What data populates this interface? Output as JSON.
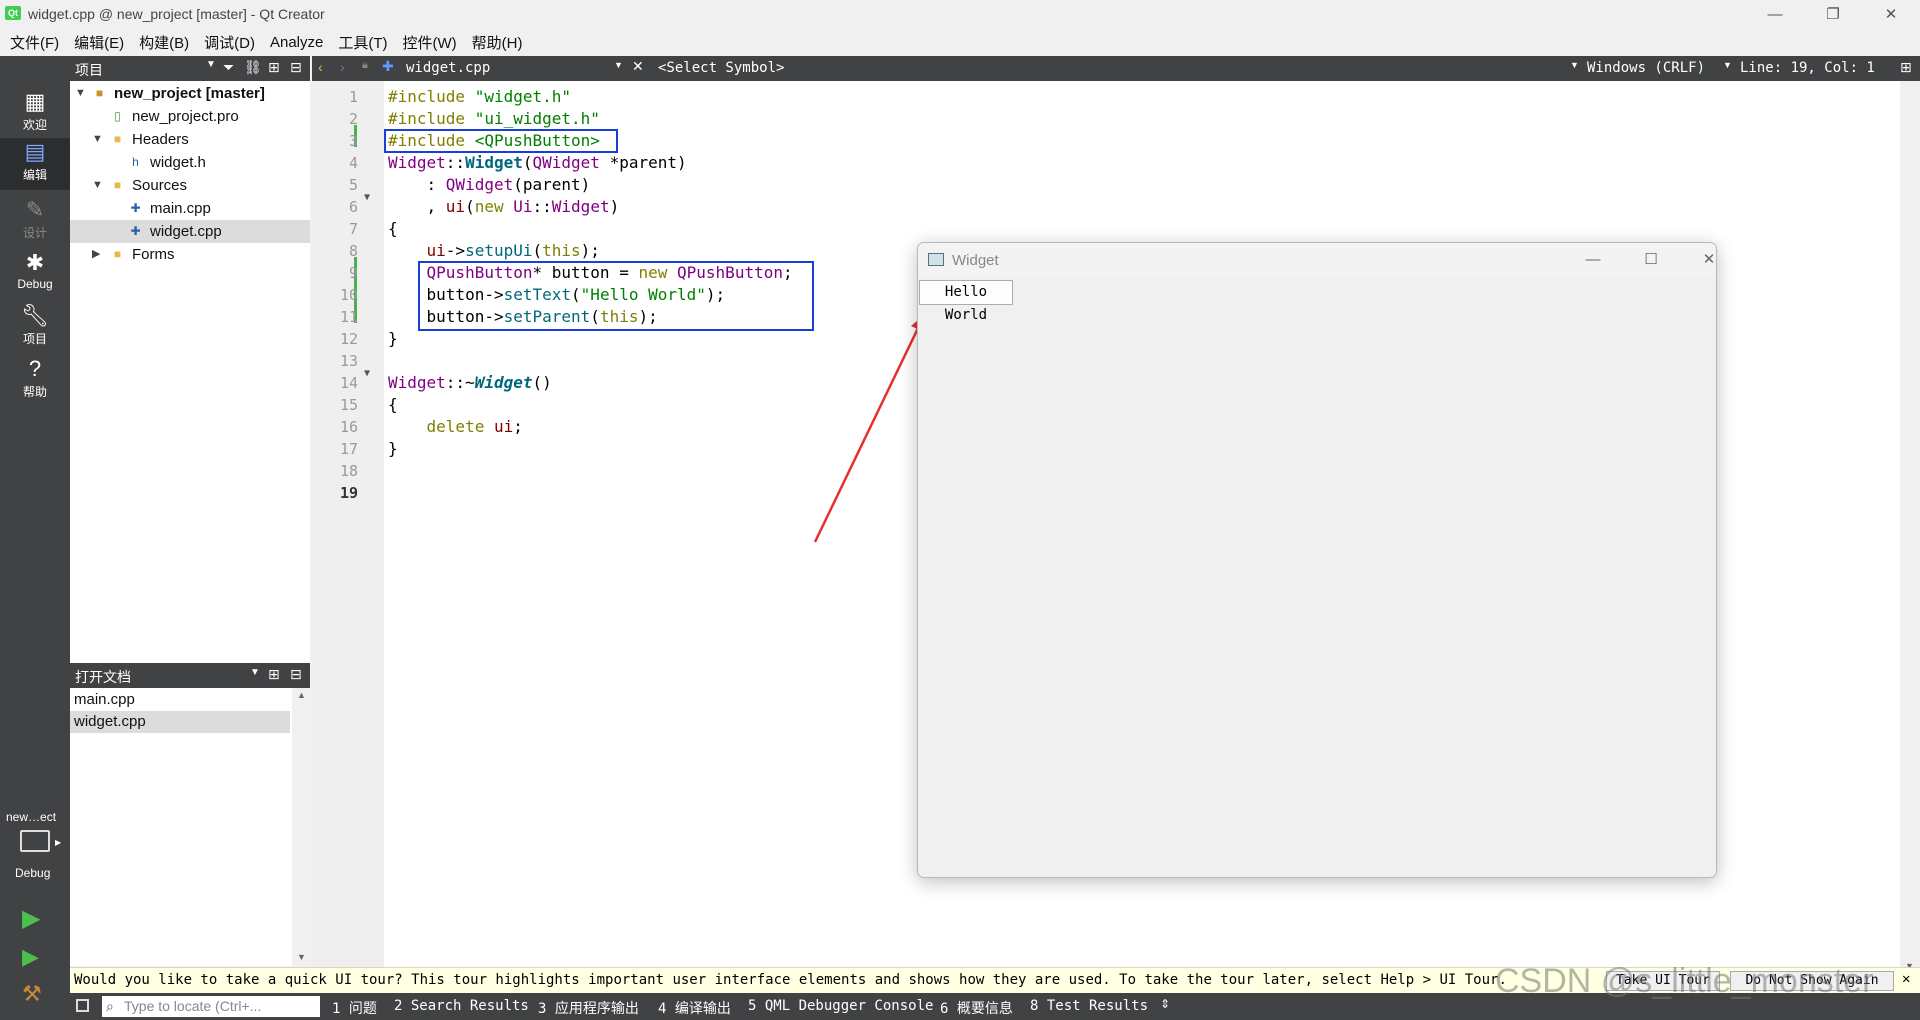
{
  "window": {
    "title": "widget.cpp @ new_project [master] - Qt Creator",
    "app_icon": "Qt"
  },
  "window_controls": {
    "minimize": "—",
    "maximize": "❐",
    "close": "✕"
  },
  "menu": [
    "文件(F)",
    "编辑(E)",
    "构建(B)",
    "调试(D)",
    "Analyze",
    "工具(T)",
    "控件(W)",
    "帮助(H)"
  ],
  "modes": [
    {
      "label": "欢迎",
      "icon": "grid-icon"
    },
    {
      "label": "编辑",
      "icon": "edit-icon"
    },
    {
      "label": "设计",
      "icon": "pencil-icon"
    },
    {
      "label": "Debug",
      "icon": "bug-icon"
    },
    {
      "label": "项目",
      "icon": "wrench-icon"
    },
    {
      "label": "帮助",
      "icon": "help-icon"
    }
  ],
  "kit": {
    "project": "new…ect",
    "config": "Debug"
  },
  "project_pane": {
    "title": "项目",
    "tree": [
      {
        "label": "new_project [master]",
        "bold": true
      },
      {
        "label": "new_project.pro"
      },
      {
        "label": "Headers"
      },
      {
        "label": "widget.h"
      },
      {
        "label": "Sources"
      },
      {
        "label": "main.cpp"
      },
      {
        "label": "widget.cpp",
        "selected": true
      },
      {
        "label": "Forms"
      }
    ]
  },
  "open_docs": {
    "title": "打开文档",
    "items": [
      {
        "label": "main.cpp"
      },
      {
        "label": "widget.cpp",
        "selected": true
      }
    ]
  },
  "editor_toolbar": {
    "file": "widget.cpp",
    "symbol": "<Select Symbol>",
    "line_ending": "Windows (CRLF)",
    "position": "Line: 19, Col: 1"
  },
  "line_numbers": [
    "1",
    "2",
    "3",
    "4",
    "5",
    "6",
    "7",
    "8",
    "9",
    "10",
    "11",
    "12",
    "13",
    "14",
    "15",
    "16",
    "17",
    "18",
    "19"
  ],
  "code": {
    "l1a": "#include ",
    "l1b": "\"widget.h\"",
    "l2a": "#include ",
    "l2b": "\"ui_widget.h\"",
    "l3a": "#include ",
    "l3b": "<QPushButton>",
    "l4a": "Widget",
    "l4b": "::",
    "l4c": "Widget",
    "l4d": "(",
    "l4e": "QWidget",
    "l4f": " *",
    "l4g": "parent",
    "l4h": ")",
    "l5a": "    : ",
    "l5b": "QWidget",
    "l5c": "(",
    "l5d": "parent",
    "l5e": ")",
    "l6a": "    , ",
    "l6b": "ui",
    "l6c": "(",
    "l6d": "new",
    "l6e": " ",
    "l6f": "Ui",
    "l6g": "::",
    "l6h": "Widget",
    "l6i": ")",
    "l7": "{",
    "l8a": "    ",
    "l8b": "ui",
    "l8c": "->",
    "l8d": "setupUi",
    "l8e": "(",
    "l8f": "this",
    "l8g": ");",
    "l9a": "    ",
    "l9b": "QPushButton",
    "l9c": "* button = ",
    "l9d": "new",
    "l9e": " ",
    "l9f": "QPushButton",
    "l9g": ";",
    "l10a": "    button->",
    "l10b": "setText",
    "l10c": "(",
    "l10d": "\"Hello World\"",
    "l10e": ");",
    "l11a": "    button->",
    "l11b": "setParent",
    "l11c": "(",
    "l11d": "this",
    "l11e": ");",
    "l12": "}",
    "l14a": "Widget",
    "l14b": "::~",
    "l14c": "Widget",
    "l14d": "()",
    "l15": "{",
    "l16a": "    ",
    "l16b": "delete",
    "l16c": " ",
    "l16d": "ui",
    "l16e": ";",
    "l17": "}"
  },
  "widget_window": {
    "title": "Widget",
    "button": "Hello World"
  },
  "tour": {
    "message": "Would you like to take a quick UI tour? This tour highlights important user interface elements and shows how they are used. To take the tour later, select Help > UI Tour.",
    "take": "Take UI Tour",
    "dismiss": "Do Not Show Again"
  },
  "statusbar": {
    "locate_placeholder": "Type to locate (Ctrl+...",
    "panes": [
      "1 问题",
      "2 Search Results",
      "3 应用程序输出",
      "4 编译输出",
      "5 QML Debugger Console",
      "6 概要信息",
      "8 Test Results"
    ]
  },
  "watermark": "CSDN @s_little_monster",
  "colors": {
    "dark_panel": "#404244",
    "highlight_box": "#1a3fd8",
    "arrow": "#e53030"
  }
}
